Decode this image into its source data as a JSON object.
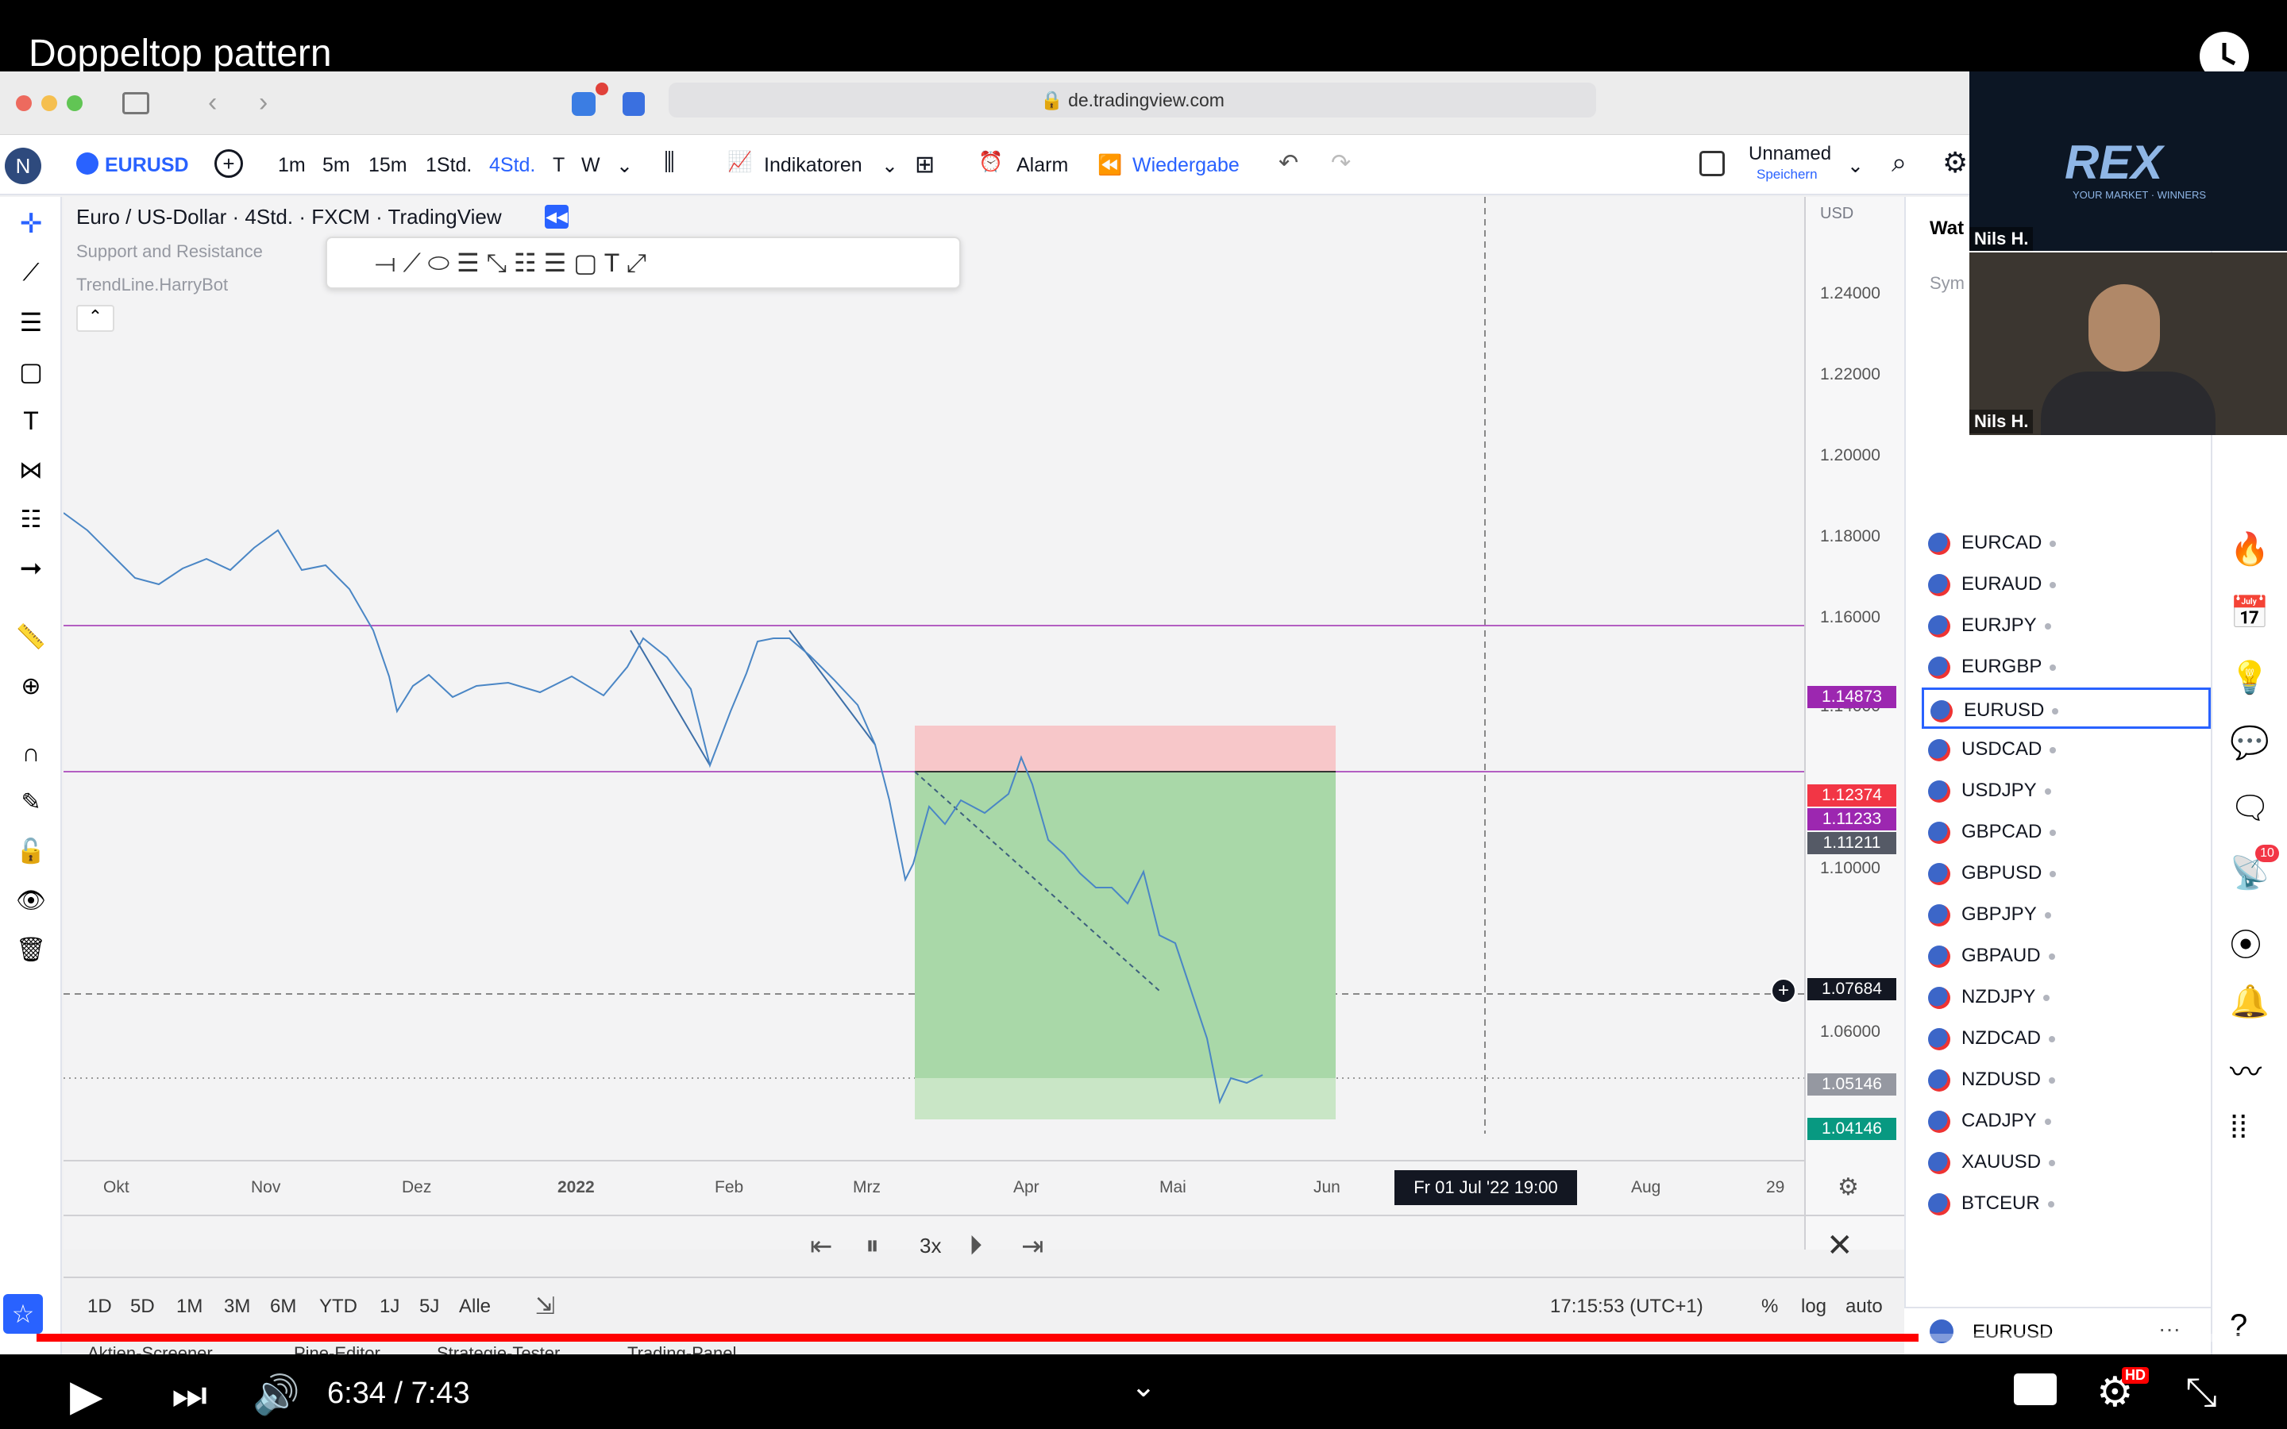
{
  "video": {
    "title": "Doppeltop pattern",
    "time": "6:34 / 7:43",
    "progress": 0.851
  },
  "browser": {
    "url": "de.tradingview.com"
  },
  "toolbar": {
    "symbol": "EURUSD",
    "intervals": [
      "1m",
      "5m",
      "15m",
      "1Std.",
      "4Std.",
      "T",
      "W"
    ],
    "active_interval": "4Std.",
    "indicators": "Indikatoren",
    "alarm": "Alarm",
    "replay": "Wiedergabe",
    "layout_name": "Unnamed",
    "layout_save": "Speichern"
  },
  "legend": {
    "title": "Euro / US-Dollar",
    "interval": "4Std.",
    "exchange": "FXCM",
    "source": "TradingView",
    "indicators": [
      "Support and Resistance",
      "TrendLine.HarryBot"
    ]
  },
  "price_axis": {
    "currency": "USD",
    "ticks": [
      "1.24000",
      "1.22000",
      "1.20000",
      "1.18000",
      "1.16000",
      "1.14000",
      "1.10000",
      "1.06000"
    ]
  },
  "price_labels": [
    {
      "value": "1.14873",
      "color": "#9c27b0"
    },
    {
      "value": "1.12374",
      "color": "#f23645"
    },
    {
      "value": "1.11233",
      "color": "#9c27b0"
    },
    {
      "value": "1.11211",
      "color": "#555a66"
    },
    {
      "value": "1.07684",
      "color": "#131722"
    },
    {
      "value": "1.05146",
      "color": "#9598a1"
    },
    {
      "value": "1.04146",
      "color": "#089981"
    }
  ],
  "time_axis": {
    "labels": [
      "Okt",
      "Nov",
      "Dez",
      "2022",
      "Feb",
      "Mrz",
      "Apr",
      "Mai",
      "Jun",
      "Aug",
      "29"
    ],
    "crosshair": "Fr 01 Jul '22   19:00"
  },
  "replay_bar": {
    "speed": "3x"
  },
  "bottom_bar": {
    "ranges": [
      "1D",
      "5D",
      "1M",
      "3M",
      "6M",
      "YTD",
      "1J",
      "5J",
      "Alle"
    ],
    "time": "17:15:53 (UTC+1)",
    "toggles": [
      "%",
      "log",
      "auto"
    ],
    "tabs": [
      "Aktien-Screener",
      "Pine-Editor",
      "Strategie-Tester",
      "Trading-Panel"
    ]
  },
  "watchlist": {
    "header": "Wat",
    "col": "Sym",
    "symbols": [
      "EURCAD",
      "EURAUD",
      "EURJPY",
      "EURGBP",
      "EURUSD",
      "USDCAD",
      "USDJPY",
      "GBPCAD",
      "GBPUSD",
      "GBPJPY",
      "GBPAUD",
      "NZDJPY",
      "NZDCAD",
      "NZDUSD",
      "CADJPY",
      "XAUUSD",
      "BTCEUR"
    ],
    "selected": "EURUSD",
    "footer_symbol": "EURUSD"
  },
  "webcam": {
    "name1": "Nils H.",
    "name2": "Nils H.",
    "logo": "REX",
    "logo_sub": "YOUR MARKET · WINNERS"
  },
  "badges": {
    "notifications": "10",
    "hd": "HD"
  },
  "chart_data": {
    "type": "line",
    "series_name": "EURUSD 4h",
    "x": [
      "Okt",
      "Nov",
      "Dez",
      "2022",
      "Feb",
      "Mrz",
      "Apr",
      "Mai"
    ],
    "y": [
      1.16,
      1.153,
      1.13,
      1.135,
      1.138,
      1.11,
      1.108,
      1.055
    ],
    "levels": [
      1.14873,
      1.11233,
      1.05146
    ]
  }
}
